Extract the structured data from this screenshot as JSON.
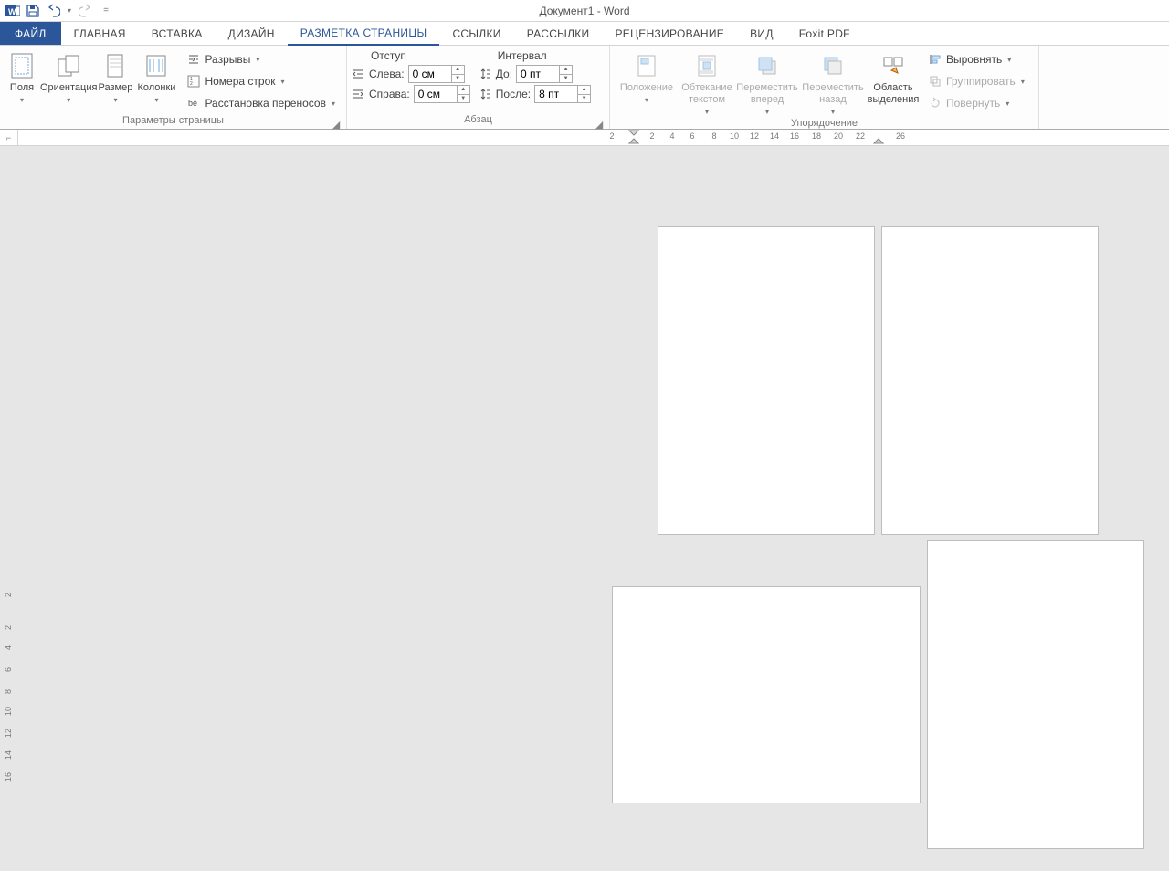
{
  "titlebar": {
    "document_title": "Документ1 - Word"
  },
  "qat": {
    "customize_caret": "⌄",
    "overflow": "="
  },
  "tabs": {
    "file": "ФАЙЛ",
    "home": "ГЛАВНАЯ",
    "insert": "ВСТАВКА",
    "design": "ДИЗАЙН",
    "page_layout": "РАЗМЕТКА СТРАНИЦЫ",
    "references": "ССЫЛКИ",
    "mailings": "РАССЫЛКИ",
    "review": "РЕЦЕНЗИРОВАНИЕ",
    "view": "ВИД",
    "foxit": "Foxit PDF"
  },
  "ribbon": {
    "page_setup": {
      "label": "Параметры страницы",
      "margins": "Поля",
      "orientation": "Ориентация",
      "size": "Размер",
      "columns": "Колонки",
      "breaks": "Разрывы",
      "line_numbers": "Номера строк",
      "hyphenation": "Расстановка переносов"
    },
    "paragraph": {
      "label": "Абзац",
      "indent_header": "Отступ",
      "spacing_header": "Интервал",
      "left_label": "Слева:",
      "right_label": "Справа:",
      "before_label": "До:",
      "after_label": "После:",
      "left_value": "0 см",
      "right_value": "0 см",
      "before_value": "0 пт",
      "after_value": "8 пт"
    },
    "arrange": {
      "label": "Упорядочение",
      "position": "Положение",
      "wrap_text": "Обтекание текстом",
      "bring_forward": "Переместить вперед",
      "send_backward": "Переместить назад",
      "selection_pane": "Область выделения",
      "align": "Выровнять",
      "group": "Группировать",
      "rotate": "Повернуть"
    }
  },
  "ruler": {
    "corner": "⌐",
    "h_numbers": [
      "2",
      "2",
      "4",
      "6",
      "8",
      "10",
      "12",
      "14",
      "16",
      "18",
      "20",
      "22",
      "26"
    ],
    "v_numbers": [
      "2",
      "2",
      "4",
      "6",
      "8",
      "10",
      "12",
      "14",
      "16"
    ]
  }
}
